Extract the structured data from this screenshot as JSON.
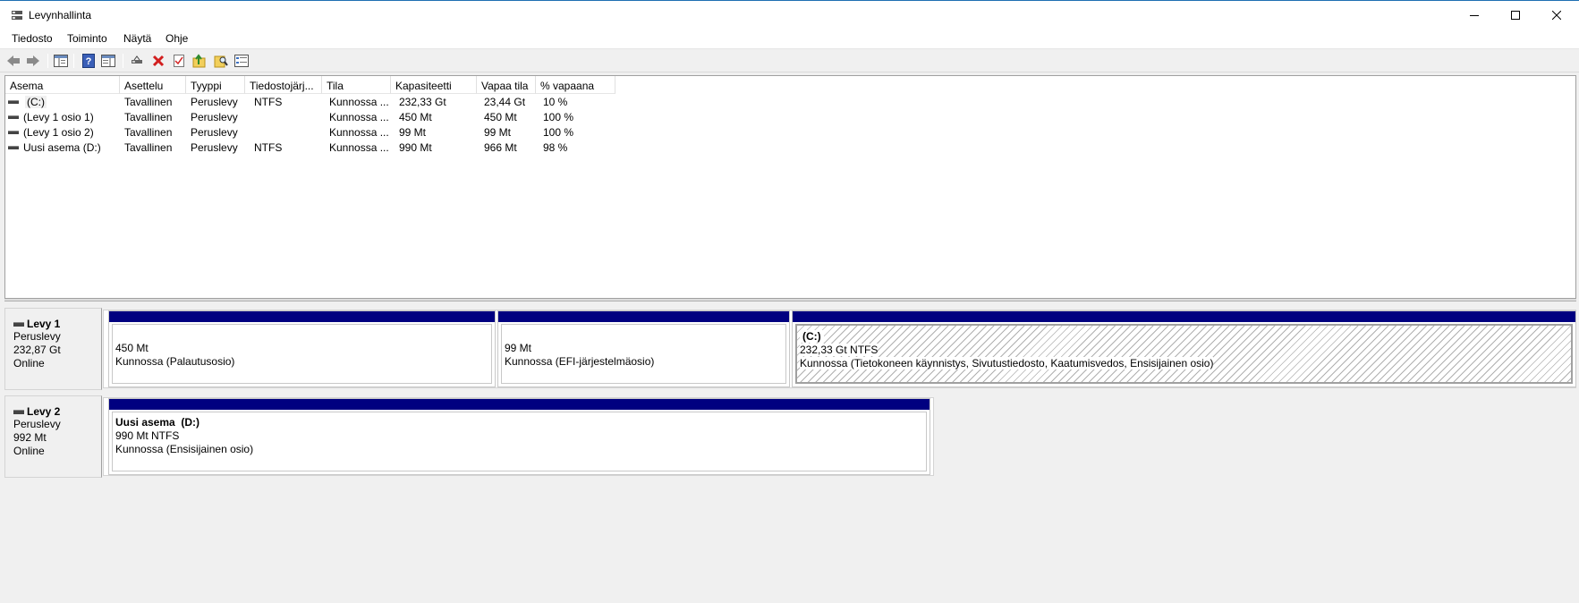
{
  "window": {
    "title": "Levynhallinta"
  },
  "menu": [
    "Tiedosto",
    "Toiminto",
    "Näytä",
    "Ohje"
  ],
  "toolbar_icons": [
    "back-icon",
    "forward-icon",
    "console-tree-icon",
    "help-icon",
    "properties-pane-icon",
    "connect-icon",
    "delete-icon",
    "check-icon",
    "folder-up-icon",
    "search-folder-icon",
    "settings-list-icon"
  ],
  "volume_list": {
    "columns": [
      "Asema",
      "Asettelu",
      "Tyyppi",
      "Tiedostojärj...",
      "Tila",
      "Kapasiteetti",
      "Vapaa tila",
      "% vapaana"
    ],
    "rows": [
      [
        "(C:)",
        "Tavallinen",
        "Peruslevy",
        "NTFS",
        "Kunnossa ...",
        "232,33 Gt",
        "23,44 Gt",
        "10 %"
      ],
      [
        "(Levy 1 osio 1)",
        "Tavallinen",
        "Peruslevy",
        "",
        "Kunnossa ...",
        "450 Mt",
        "450 Mt",
        "100 %"
      ],
      [
        "(Levy 1 osio 2)",
        "Tavallinen",
        "Peruslevy",
        "",
        "Kunnossa ...",
        "99 Mt",
        "99 Mt",
        "100 %"
      ],
      [
        "Uusi asema (D:)",
        "Tavallinen",
        "Peruslevy",
        "NTFS",
        "Kunnossa ...",
        "990 Mt",
        "966 Mt",
        "98 %"
      ]
    ]
  },
  "disks": [
    {
      "name": "Levy 1",
      "type": "Peruslevy",
      "size": "232,87 Gt",
      "status": "Online",
      "partitions": [
        {
          "title": "",
          "size": "450 Mt",
          "status": "Kunnossa (Palautusosio)"
        },
        {
          "title": "",
          "size": "99 Mt",
          "status": "Kunnossa (EFI-järjestelmäosio)"
        },
        {
          "title": "(C:)",
          "size": "232,33 Gt NTFS",
          "status": "Kunnossa (Tietokoneen käynnistys, Sivutustiedosto, Kaatumisvedos, Ensisijainen osio)"
        }
      ]
    },
    {
      "name": "Levy 2",
      "type": "Peruslevy",
      "size": "992 Mt",
      "status": "Online",
      "partitions": [
        {
          "title": "Uusi asema  (D:)",
          "size": "990 Mt NTFS",
          "status": "Kunnossa (Ensisijainen osio)"
        }
      ]
    }
  ],
  "colors": {
    "partition_bar": "#000080",
    "title_border": "#1f6fb2"
  }
}
